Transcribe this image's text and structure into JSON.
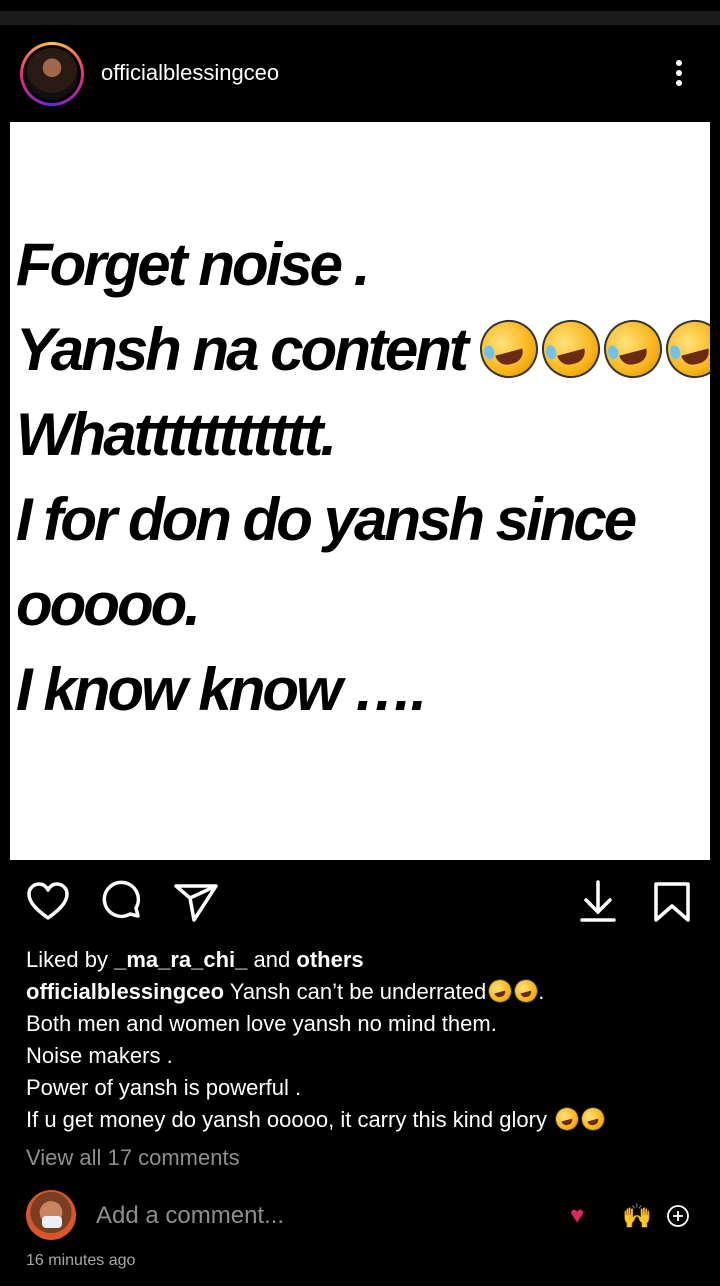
{
  "post": {
    "username": "officialblessingceo",
    "image_lines": [
      "Forget noise .",
      "Yansh na content",
      "Whattttttttttt.",
      "I for don do yansh since",
      "ooooo.",
      "I know know …."
    ],
    "image_line2_suffix": "..",
    "image_emoji_icon": "rolling-laughing-emoji-icon",
    "liked_by_prefix": "Liked by",
    "liked_by_user": "_ma_ra_chi_",
    "liked_by_and": "and",
    "liked_by_others": "others",
    "caption_user": "officialblessingceo",
    "caption_lines": [
      "Yansh can’t be underrated",
      "Both men and women love yansh no mind them.",
      "Noise makers .",
      "Power of yansh is powerful .",
      "If u get money do yansh ooooo, it carry this kind glory"
    ],
    "caption_line1_suffix": ".",
    "view_comments": "View all 17 comments",
    "comment_placeholder": "Add a comment...",
    "timestamp": "16 minutes ago"
  },
  "icons": {
    "more": "more-vertical-icon",
    "like": "heart-icon",
    "comment": "comment-bubble-icon",
    "share": "send-icon",
    "download": "download-icon",
    "save": "bookmark-icon",
    "react_heart": "red-heart-emoji-icon",
    "react_hands": "raised-hands-emoji-icon",
    "react_add": "add-circle-icon"
  },
  "colors": {
    "background": "#000000",
    "secondary_text": "#8e8e8e",
    "heart_red": "#e0245e"
  }
}
